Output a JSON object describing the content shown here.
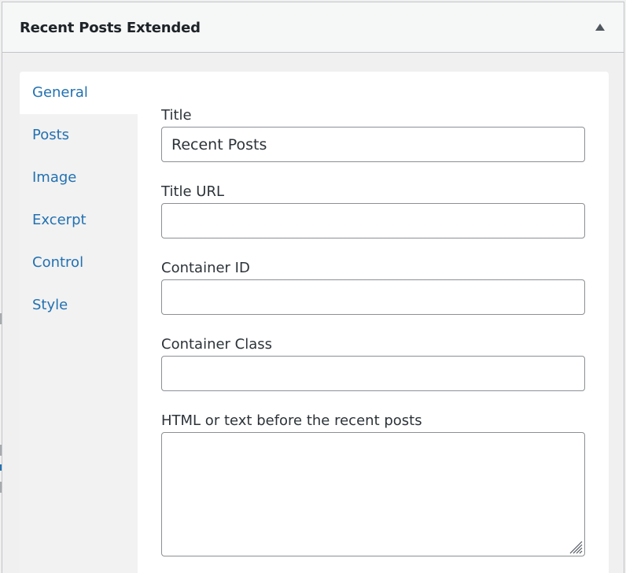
{
  "widget": {
    "title": "Recent Posts Extended"
  },
  "tabs": [
    {
      "label": "General",
      "active": true
    },
    {
      "label": "Posts",
      "active": false
    },
    {
      "label": "Image",
      "active": false
    },
    {
      "label": "Excerpt",
      "active": false
    },
    {
      "label": "Control",
      "active": false
    },
    {
      "label": "Style",
      "active": false
    }
  ],
  "fields": {
    "title": {
      "label": "Title",
      "value": "Recent Posts"
    },
    "title_url": {
      "label": "Title URL",
      "value": ""
    },
    "container_id": {
      "label": "Container ID",
      "value": ""
    },
    "container_class": {
      "label": "Container Class",
      "value": ""
    },
    "before_html": {
      "label": "HTML or text before the recent posts",
      "value": ""
    }
  },
  "colors": {
    "link": "#2271b1",
    "border": "#8c8f94",
    "panel_bg": "#f0f0f1"
  },
  "icons": {
    "toggle": "triangle-up-icon",
    "resize": "resize-grip-icon"
  }
}
